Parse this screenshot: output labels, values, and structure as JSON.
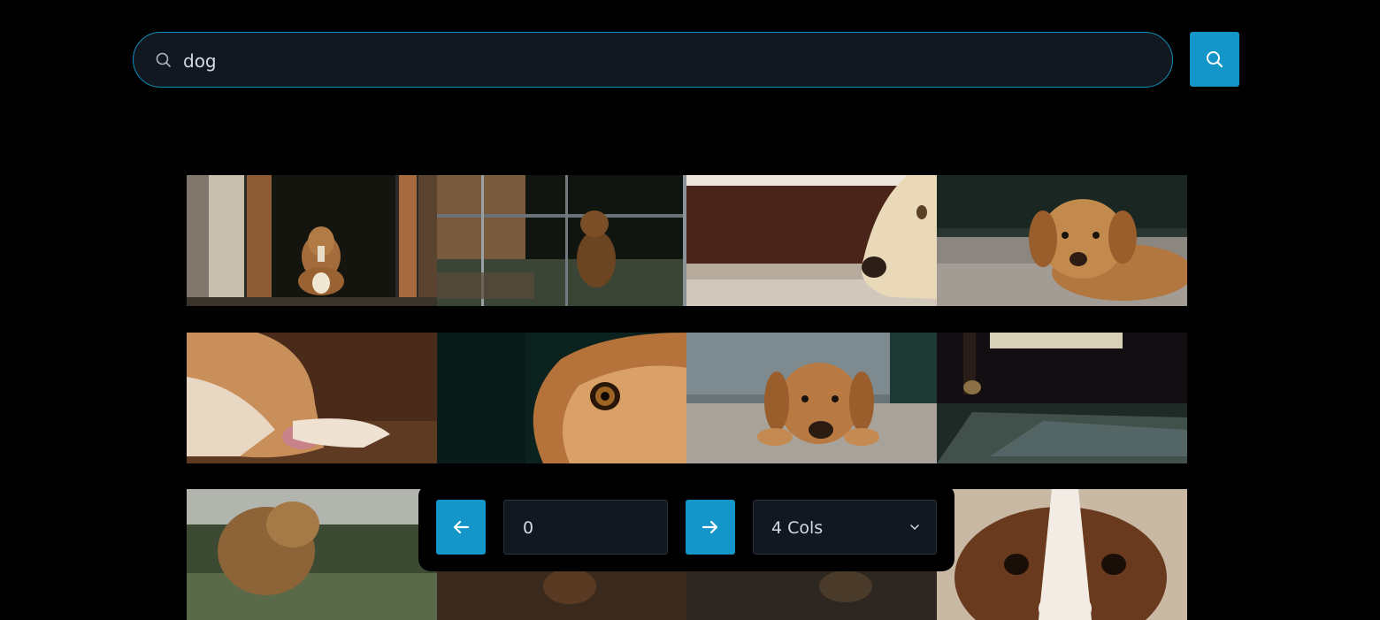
{
  "search": {
    "query": "dog"
  },
  "colors": {
    "accent": "#1496c8",
    "field_bg": "#111820",
    "border": "#138fbd",
    "text": "#d4dae2"
  },
  "gallery": {
    "images": [
      "dog-in-doorway",
      "dog-behind-fence",
      "white-dog-nose-closeup",
      "puppy-lying-on-carpet",
      "dog-lying-sideways",
      "dog-eye-closeup",
      "puppy-lying-on-floor",
      "dark-room-floor",
      "dog-outdoors",
      "puppy-face-closeup"
    ]
  },
  "pagination": {
    "page": "0",
    "columns_label": "4 Cols",
    "prev_icon": "arrow-left-icon",
    "next_icon": "arrow-right-icon"
  }
}
